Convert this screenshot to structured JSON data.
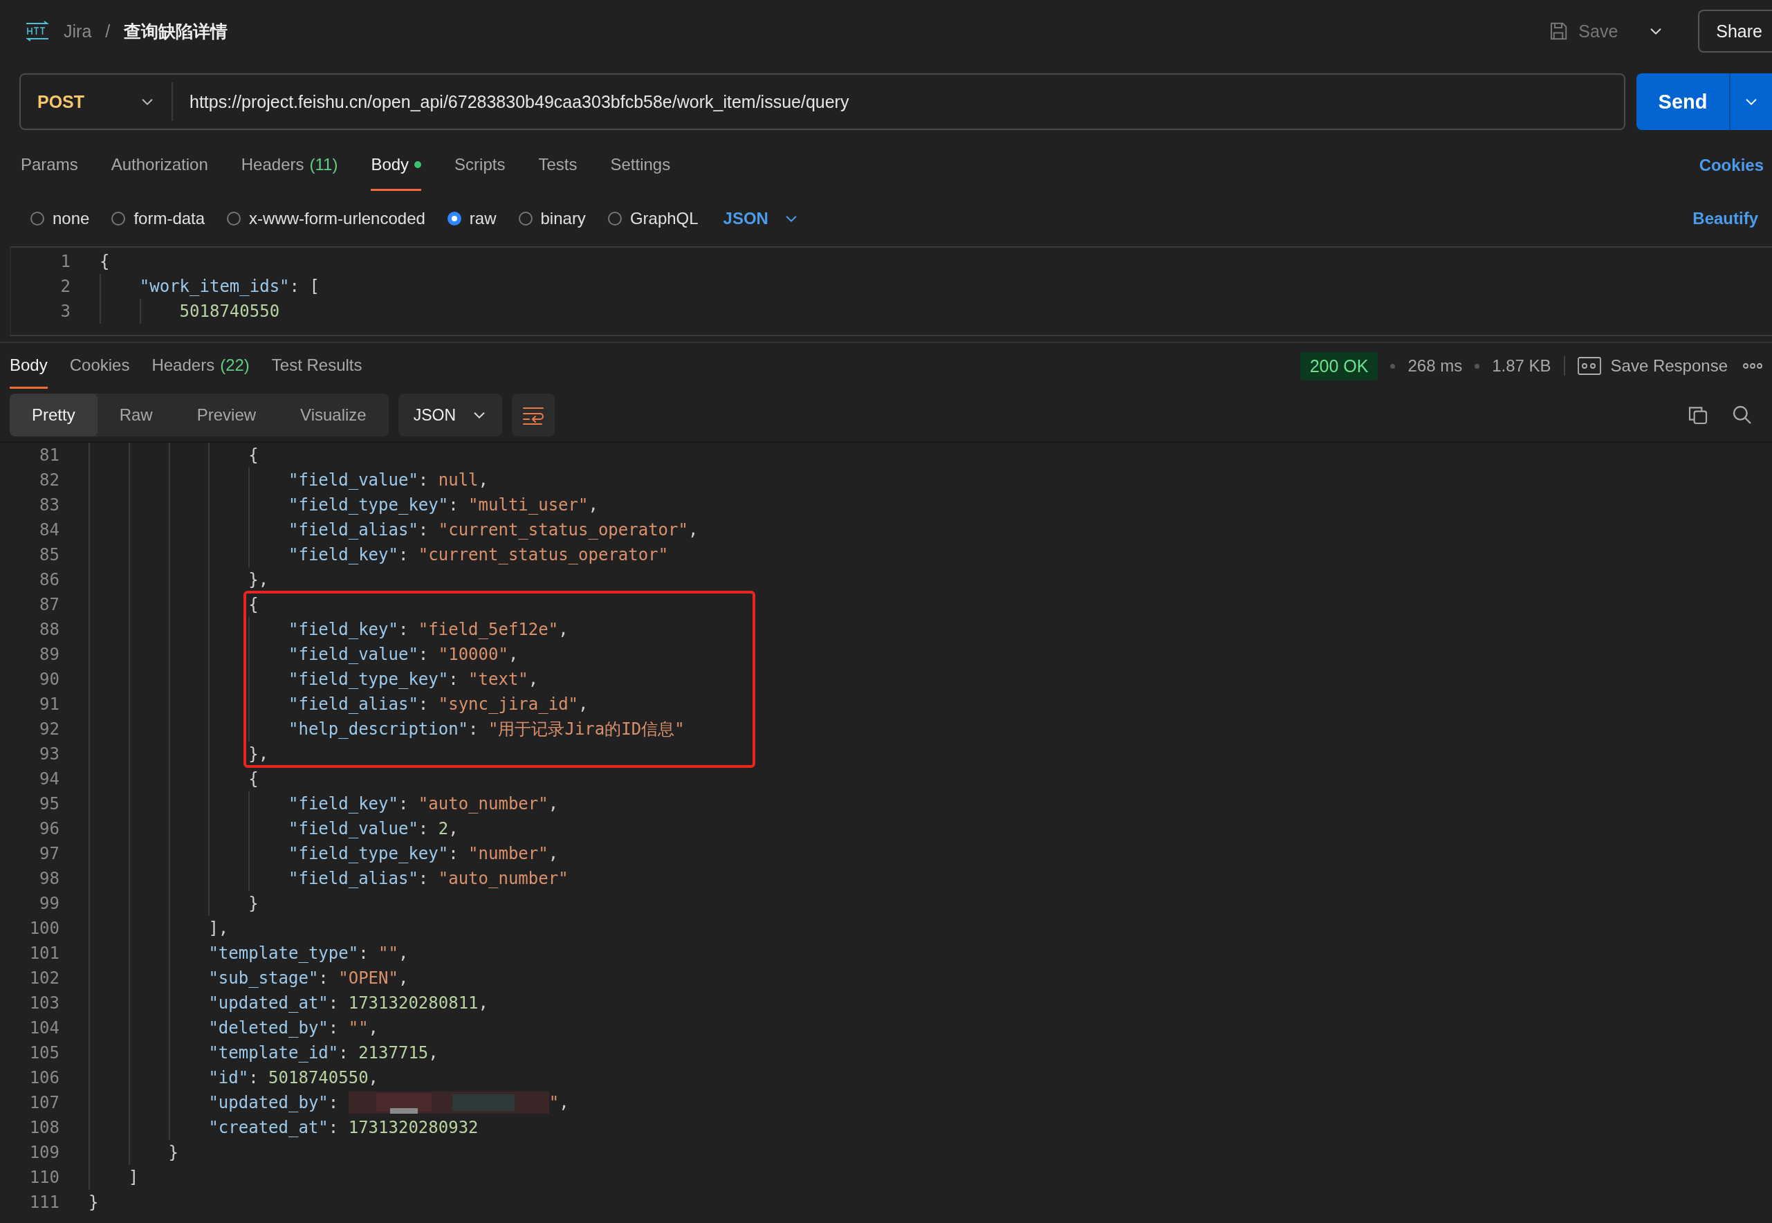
{
  "header": {
    "parent": "Jira",
    "separator": "/",
    "title": "查询缺陷详情",
    "save": {
      "label": "Save",
      "disabled": true
    },
    "share": "Share"
  },
  "request": {
    "method": "POST",
    "url": "https://project.feishu.cn/open_api/67283830b49caa303bfcb58e/work_item/issue/query",
    "send": "Send"
  },
  "request_tabs": [
    {
      "label": "Params",
      "selected": false,
      "modified": false
    },
    {
      "label": "Authorization",
      "selected": false,
      "modified": false
    },
    {
      "label": "Headers",
      "count": "(11)",
      "selected": false,
      "modified": false
    },
    {
      "label": "Body",
      "selected": true,
      "modified": true
    },
    {
      "label": "Scripts",
      "selected": false,
      "modified": false
    },
    {
      "label": "Tests",
      "selected": false,
      "modified": false
    },
    {
      "label": "Settings",
      "selected": false,
      "modified": false
    }
  ],
  "cookies_link": "Cookies",
  "body_types": [
    {
      "label": "none",
      "selected": false
    },
    {
      "label": "form-data",
      "selected": false
    },
    {
      "label": "x-www-form-urlencoded",
      "selected": false
    },
    {
      "label": "raw",
      "selected": true
    },
    {
      "label": "binary",
      "selected": false
    },
    {
      "label": "GraphQL",
      "selected": false
    }
  ],
  "body_format": "JSON",
  "beautify": "Beautify",
  "request_body": [
    {
      "number": "1",
      "tokens": [
        {
          "kind": "punct",
          "text": "{"
        }
      ]
    },
    {
      "number": "2",
      "tokens": [
        {
          "kind": "key",
          "text": "\"work_item_ids\""
        },
        {
          "kind": "punct",
          "text": ": ["
        }
      ]
    },
    {
      "number": "3",
      "tokens": [
        {
          "kind": "number",
          "text": "5018740550"
        }
      ]
    }
  ],
  "response": {
    "tabs": [
      {
        "label": "Body",
        "selected": true
      },
      {
        "label": "Cookies",
        "selected": false
      },
      {
        "label": "Headers",
        "count": "(22)",
        "selected": false
      },
      {
        "label": "Test Results",
        "selected": false
      }
    ],
    "status": "200 OK",
    "time": "268 ms",
    "size": "1.87 KB",
    "save_response": "Save Response",
    "view_modes": [
      {
        "label": "Pretty",
        "selected": true
      },
      {
        "label": "Raw",
        "selected": false
      },
      {
        "label": "Preview",
        "selected": false
      },
      {
        "label": "Visualize",
        "selected": false
      }
    ],
    "format": "JSON",
    "blocks": [
      {
        "kind": "plain",
        "lines": [
          {
            "number": "81",
            "tokens": [
              {
                "kind": "punct",
                "text": "{"
              }
            ]
          },
          {
            "number": "82",
            "tokens": [
              {
                "kind": "key",
                "text": "\"field_value\""
              },
              {
                "kind": "punct",
                "text": ": "
              },
              {
                "kind": "null",
                "text": "null"
              },
              {
                "kind": "punct",
                "text": ","
              }
            ]
          },
          {
            "number": "83",
            "tokens": [
              {
                "kind": "key",
                "text": "\"field_type_key\""
              },
              {
                "kind": "punct",
                "text": ": "
              },
              {
                "kind": "string",
                "text": "\"multi_user\""
              },
              {
                "kind": "punct",
                "text": ","
              }
            ]
          },
          {
            "number": "84",
            "tokens": [
              {
                "kind": "key",
                "text": "\"field_alias\""
              },
              {
                "kind": "punct",
                "text": ": "
              },
              {
                "kind": "string",
                "text": "\"current_status_operator\""
              },
              {
                "kind": "punct",
                "text": ","
              }
            ]
          },
          {
            "number": "85",
            "tokens": [
              {
                "kind": "key",
                "text": "\"field_key\""
              },
              {
                "kind": "punct",
                "text": ": "
              },
              {
                "kind": "string",
                "text": "\"current_status_operator\""
              }
            ]
          },
          {
            "number": "86",
            "tokens": [
              {
                "kind": "punct",
                "text": "},"
              }
            ]
          }
        ]
      },
      {
        "kind": "highlighted",
        "lines": [
          {
            "number": "87",
            "tokens": [
              {
                "kind": "punct",
                "text": "{"
              }
            ]
          },
          {
            "number": "88",
            "tokens": [
              {
                "kind": "key",
                "text": "\"field_key\""
              },
              {
                "kind": "punct",
                "text": ": "
              },
              {
                "kind": "string",
                "text": "\"field_5ef12e\""
              },
              {
                "kind": "punct",
                "text": ","
              }
            ]
          },
          {
            "number": "89",
            "tokens": [
              {
                "kind": "key",
                "text": "\"field_value\""
              },
              {
                "kind": "punct",
                "text": ": "
              },
              {
                "kind": "string",
                "text": "\"10000\""
              },
              {
                "kind": "punct",
                "text": ","
              }
            ]
          },
          {
            "number": "90",
            "tokens": [
              {
                "kind": "key",
                "text": "\"field_type_key\""
              },
              {
                "kind": "punct",
                "text": ": "
              },
              {
                "kind": "string",
                "text": "\"text\""
              },
              {
                "kind": "punct",
                "text": ","
              }
            ]
          },
          {
            "number": "91",
            "tokens": [
              {
                "kind": "key",
                "text": "\"field_alias\""
              },
              {
                "kind": "punct",
                "text": ": "
              },
              {
                "kind": "string",
                "text": "\"sync_jira_id\""
              },
              {
                "kind": "punct",
                "text": ","
              }
            ]
          },
          {
            "number": "92",
            "tokens": [
              {
                "kind": "key",
                "text": "\"help_description\""
              },
              {
                "kind": "punct",
                "text": ": "
              },
              {
                "kind": "string",
                "text": "\"用于记录Jira的ID信息\""
              }
            ]
          },
          {
            "number": "93",
            "tokens": [
              {
                "kind": "punct",
                "text": "},"
              }
            ]
          }
        ]
      },
      {
        "kind": "plain",
        "lines": [
          {
            "number": "94",
            "tokens": [
              {
                "kind": "punct",
                "text": "{"
              }
            ]
          },
          {
            "number": "95",
            "tokens": [
              {
                "kind": "key",
                "text": "\"field_key\""
              },
              {
                "kind": "punct",
                "text": ": "
              },
              {
                "kind": "string",
                "text": "\"auto_number\""
              },
              {
                "kind": "punct",
                "text": ","
              }
            ]
          },
          {
            "number": "96",
            "tokens": [
              {
                "kind": "key",
                "text": "\"field_value\""
              },
              {
                "kind": "punct",
                "text": ": "
              },
              {
                "kind": "number",
                "text": "2"
              },
              {
                "kind": "punct",
                "text": ","
              }
            ]
          },
          {
            "number": "97",
            "tokens": [
              {
                "kind": "key",
                "text": "\"field_type_key\""
              },
              {
                "kind": "punct",
                "text": ": "
              },
              {
                "kind": "string",
                "text": "\"number\""
              },
              {
                "kind": "punct",
                "text": ","
              }
            ]
          },
          {
            "number": "98",
            "tokens": [
              {
                "kind": "key",
                "text": "\"field_alias\""
              },
              {
                "kind": "punct",
                "text": ": "
              },
              {
                "kind": "string",
                "text": "\"auto_number\""
              }
            ]
          },
          {
            "number": "99",
            "tokens": [
              {
                "kind": "punct",
                "text": "}"
              }
            ]
          },
          {
            "number": "100",
            "tokens": [
              {
                "kind": "punct",
                "text": "],"
              }
            ]
          },
          {
            "number": "101",
            "tokens": [
              {
                "kind": "key",
                "text": "\"template_type\""
              },
              {
                "kind": "punct",
                "text": ": "
              },
              {
                "kind": "string",
                "text": "\"\""
              },
              {
                "kind": "punct",
                "text": ","
              }
            ]
          },
          {
            "number": "102",
            "tokens": [
              {
                "kind": "key",
                "text": "\"sub_stage\""
              },
              {
                "kind": "punct",
                "text": ": "
              },
              {
                "kind": "string",
                "text": "\"OPEN\""
              },
              {
                "kind": "punct",
                "text": ","
              }
            ]
          },
          {
            "number": "103",
            "tokens": [
              {
                "kind": "key",
                "text": "\"updated_at\""
              },
              {
                "kind": "punct",
                "text": ": "
              },
              {
                "kind": "number",
                "text": "1731320280811"
              },
              {
                "kind": "punct",
                "text": ","
              }
            ]
          },
          {
            "number": "104",
            "tokens": [
              {
                "kind": "key",
                "text": "\"deleted_by\""
              },
              {
                "kind": "punct",
                "text": ": "
              },
              {
                "kind": "string",
                "text": "\"\""
              },
              {
                "kind": "punct",
                "text": ","
              }
            ]
          },
          {
            "number": "105",
            "tokens": [
              {
                "kind": "key",
                "text": "\"template_id\""
              },
              {
                "kind": "punct",
                "text": ": "
              },
              {
                "kind": "number",
                "text": "2137715"
              },
              {
                "kind": "punct",
                "text": ","
              }
            ]
          },
          {
            "number": "106",
            "tokens": [
              {
                "kind": "key",
                "text": "\"id\""
              },
              {
                "kind": "punct",
                "text": ": "
              },
              {
                "kind": "number",
                "text": "5018740550"
              },
              {
                "kind": "punct",
                "text": ","
              }
            ]
          },
          {
            "number": "107",
            "tokens": [
              {
                "kind": "key",
                "text": "\"updated_by\""
              },
              {
                "kind": "punct",
                "text": ": "
              },
              {
                "kind": "redacted"
              },
              {
                "kind": "string",
                "text": "\""
              },
              {
                "kind": "punct",
                "text": ","
              }
            ]
          },
          {
            "number": "108",
            "tokens": [
              {
                "kind": "key",
                "text": "\"created_at\""
              },
              {
                "kind": "punct",
                "text": ": "
              },
              {
                "kind": "number",
                "text": "1731320280932"
              }
            ]
          },
          {
            "number": "109",
            "tokens": [
              {
                "kind": "punct",
                "text": "}"
              }
            ]
          },
          {
            "number": "110",
            "tokens": [
              {
                "kind": "punct",
                "text": "]"
              }
            ]
          },
          {
            "number": "111",
            "tokens": [
              {
                "kind": "punct",
                "text": "}"
              }
            ]
          }
        ]
      }
    ]
  }
}
